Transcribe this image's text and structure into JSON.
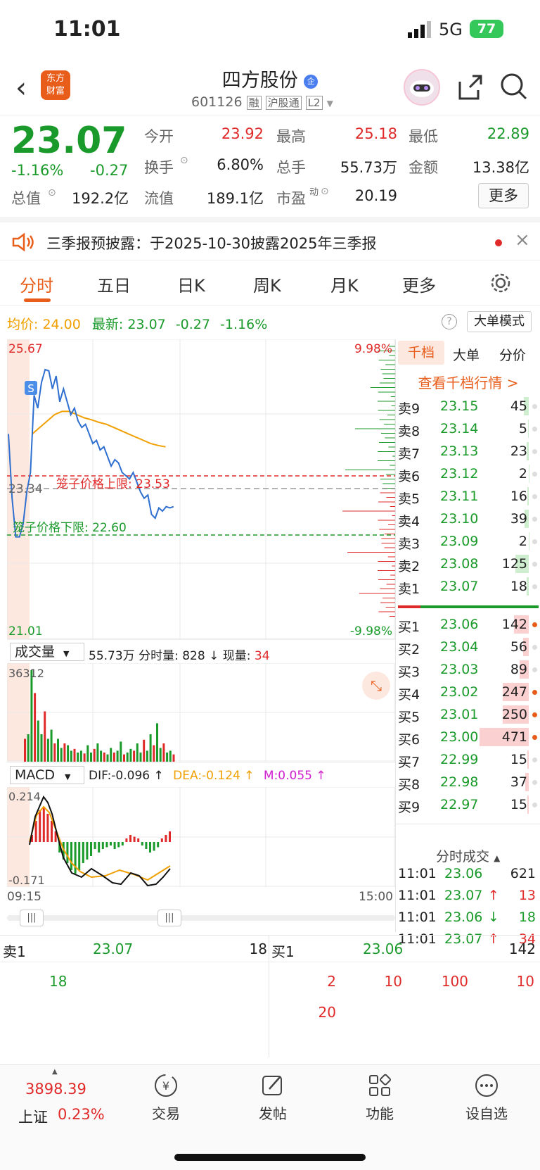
{
  "status": {
    "time": "11:01",
    "network": "5G",
    "battery": "77"
  },
  "header": {
    "title": "四方股份",
    "badge": "企",
    "code": "601126",
    "tags": [
      "融",
      "沪股通",
      "L2"
    ],
    "brand_top": "东方",
    "brand_bottom": "财富"
  },
  "quote": {
    "price": "23.07",
    "pct": "-1.16%",
    "chg": "-0.27",
    "stats": [
      {
        "label": "今开",
        "value": "23.92",
        "color": "red"
      },
      {
        "label": "最高",
        "value": "25.18",
        "color": "red"
      },
      {
        "label": "最低",
        "value": "22.89",
        "color": "green"
      },
      {
        "label": "换手",
        "value": "6.80%",
        "color": "dark"
      },
      {
        "label": "总手",
        "value": "55.73万",
        "color": "dark"
      },
      {
        "label": "金额",
        "value": "13.38亿",
        "color": "dark"
      },
      {
        "label": "总值",
        "value": "192.2亿",
        "color": "dark"
      },
      {
        "label": "流值",
        "value": "189.1亿",
        "color": "dark"
      },
      {
        "label": "市盈",
        "value": "20.19",
        "color": "dark",
        "sup": "动"
      }
    ],
    "more": "更多"
  },
  "notice": {
    "text": "三季报预披露：于2025-10-30披露2025年三季报"
  },
  "tabs": [
    "分时",
    "五日",
    "日K",
    "周K",
    "月K",
    "更多"
  ],
  "chart_info": {
    "avg_label": "均价:",
    "avg": "24.00",
    "latest_label": "最新:",
    "latest": "23.07",
    "chg": "-0.27",
    "pct": "-1.16%",
    "mode_btn": "大单模式"
  },
  "chart_data": {
    "type": "line",
    "y_top": "25.67",
    "y_mid": "23.34",
    "y_bot": "21.01",
    "pct_top": "9.98%",
    "pct_bot": "-9.98%",
    "cage_upper": "笼子价格上限: 23.53",
    "cage_lower": "笼子价格下限: 22.60",
    "marker": "S",
    "ylim": [
      21.01,
      25.67
    ],
    "price": [
      24.2,
      23.2,
      22.6,
      22.6,
      22.8,
      23.3,
      23.6,
      24.8,
      24.6,
      25.0,
      25.2,
      25.18,
      24.9,
      25.1,
      24.7,
      24.9,
      24.7,
      24.5,
      24.6,
      24.4,
      24.3,
      24.35,
      24.2,
      24.05,
      24.1,
      23.95,
      24.0,
      23.85,
      23.7,
      23.8,
      23.75,
      23.6,
      23.55,
      23.5,
      23.6,
      23.45,
      23.3,
      23.2,
      23.25,
      22.95,
      22.89,
      23.05,
      23.0,
      23.07,
      23.05,
      23.07
    ],
    "avg": [
      24.2,
      24.3,
      24.4,
      24.5,
      24.55,
      24.55,
      24.5,
      24.45,
      24.42,
      24.38,
      24.35,
      24.3,
      24.25,
      24.2,
      24.15,
      24.1,
      24.05,
      24.02,
      24.0
    ],
    "time_start": "09:15",
    "time_end": "15:00"
  },
  "volume": {
    "label": "成交量",
    "total": "55.73万",
    "fen_label": "分时量:",
    "fen": "828",
    "arrow": "↓",
    "now_label": "现量:",
    "now": "34",
    "max": "36312",
    "bars": [
      0.25,
      0.3,
      1.0,
      0.75,
      0.45,
      0.3,
      0.55,
      0.25,
      0.35,
      0.2,
      0.25,
      0.15,
      0.2,
      0.18,
      0.12,
      0.14,
      0.1,
      0.12,
      0.09,
      0.18,
      0.1,
      0.14,
      0.2,
      0.12,
      0.1,
      0.08,
      0.15,
      0.1,
      0.12,
      0.22,
      0.08,
      0.1,
      0.14,
      0.12,
      0.2,
      0.1,
      0.24,
      0.12,
      0.3,
      0.18,
      0.42,
      0.15,
      0.2,
      0.1,
      0.12,
      0.08
    ]
  },
  "macd": {
    "label": "MACD",
    "dif": "DIF:-0.096 ↑",
    "dea": "DEA:-0.124 ↑",
    "m": "M:0.055 ↑",
    "top": "0.214",
    "bot": "-0.171",
    "hist": [
      0.2,
      0.6,
      0.9,
      1.0,
      0.8,
      0.6,
      0.3,
      -0.3,
      -0.5,
      -0.6,
      -0.8,
      -0.9,
      -0.8,
      -0.6,
      -0.5,
      -0.4,
      -0.2,
      -0.3,
      -0.2,
      -0.15,
      -0.1,
      -0.2,
      -0.15,
      -0.1,
      0.1,
      0.2,
      0.15,
      0.1,
      -0.1,
      -0.2,
      -0.3,
      -0.25,
      -0.15,
      0.1,
      0.2,
      0.3
    ]
  },
  "orderbook": {
    "tabs": [
      "千档",
      "大单",
      "分价"
    ],
    "link": "查看千档行情 >",
    "sells": [
      [
        "卖9",
        "23.15",
        "45"
      ],
      [
        "卖8",
        "23.14",
        "5"
      ],
      [
        "卖7",
        "23.13",
        "23"
      ],
      [
        "卖6",
        "23.12",
        "2"
      ],
      [
        "卖5",
        "23.11",
        "16"
      ],
      [
        "卖4",
        "23.10",
        "39"
      ],
      [
        "卖3",
        "23.09",
        "2"
      ],
      [
        "卖2",
        "23.08",
        "125"
      ],
      [
        "卖1",
        "23.07",
        "18"
      ]
    ],
    "buys": [
      [
        "买1",
        "23.06",
        "142"
      ],
      [
        "买2",
        "23.04",
        "56"
      ],
      [
        "买3",
        "23.03",
        "89"
      ],
      [
        "买4",
        "23.02",
        "247"
      ],
      [
        "买5",
        "23.01",
        "250"
      ],
      [
        "买6",
        "23.00",
        "471"
      ],
      [
        "买7",
        "22.99",
        "15"
      ],
      [
        "买8",
        "22.98",
        "37"
      ],
      [
        "买9",
        "22.97",
        "15"
      ]
    ]
  },
  "ticks": {
    "title": "分时成交",
    "rows": [
      [
        "11:01",
        "23.06",
        "",
        "621"
      ],
      [
        "11:01",
        "23.07",
        "↑",
        "13"
      ],
      [
        "11:01",
        "23.06",
        "↓",
        "18"
      ],
      [
        "11:01",
        "23.07",
        "↑",
        "34"
      ]
    ]
  },
  "queue": {
    "sell_label": "卖1",
    "sell_price": "23.07",
    "sell_vol": "18",
    "buy_label": "买1",
    "buy_price": "23.06",
    "buy_vol": "142",
    "sell_items": [
      "18"
    ],
    "buy_items": [
      "2",
      "10",
      "100",
      "10",
      "20"
    ]
  },
  "bottom": {
    "index_val": "3898.39",
    "index_name": "上证",
    "index_pct": "0.23%",
    "nav": [
      "交易",
      "发帖",
      "功能",
      "设自选"
    ]
  }
}
